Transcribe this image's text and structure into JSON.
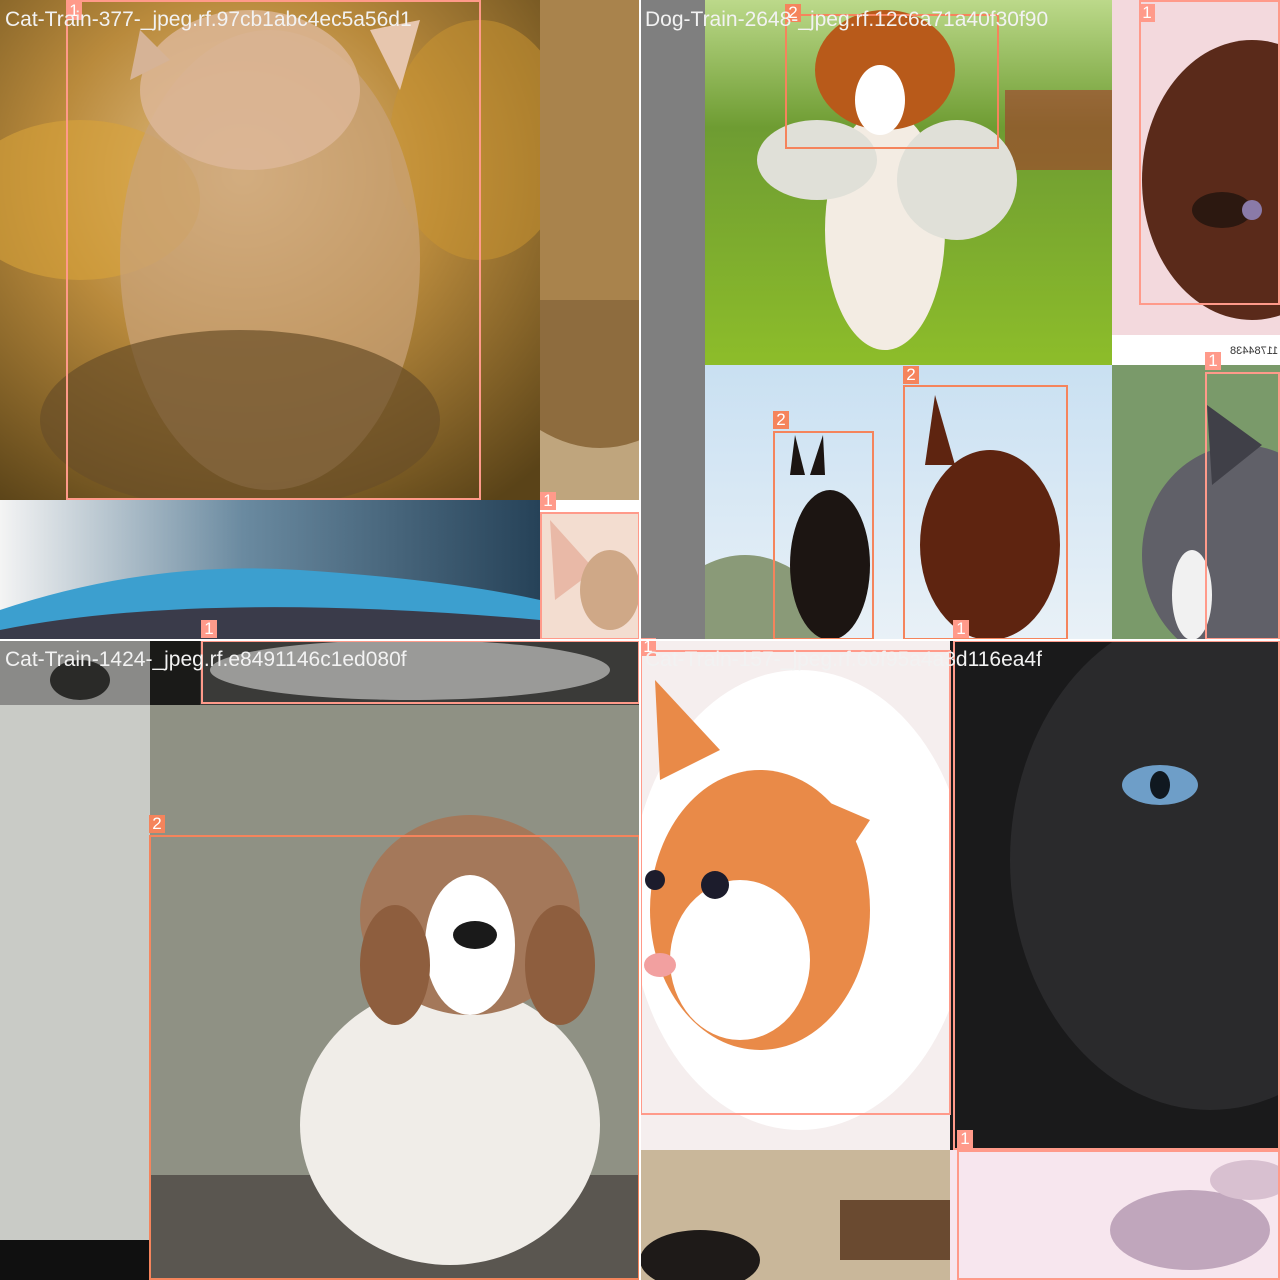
{
  "mosaic": {
    "filenames": {
      "top_left": "Cat-Train-377-_jpeg.rf.97cb1abc4ec5a56d1",
      "top_right": "Dog-Train-2648-_jpeg.rf.12c6a71a40f30f90",
      "bottom_left": "Cat-Train-1424-_jpeg.rf.e8491146c1ed080f",
      "bottom_right": "Cat-Train-157-_jpeg.rf.60f95a4a3d116ea4f"
    },
    "class_ids": {
      "cat": "1",
      "dog": "2"
    },
    "watermark_text": "11784438",
    "colors": {
      "cat_box": "#ff9a8a",
      "dog_box": "#f5845c",
      "padding": "#7f7f7f"
    }
  }
}
